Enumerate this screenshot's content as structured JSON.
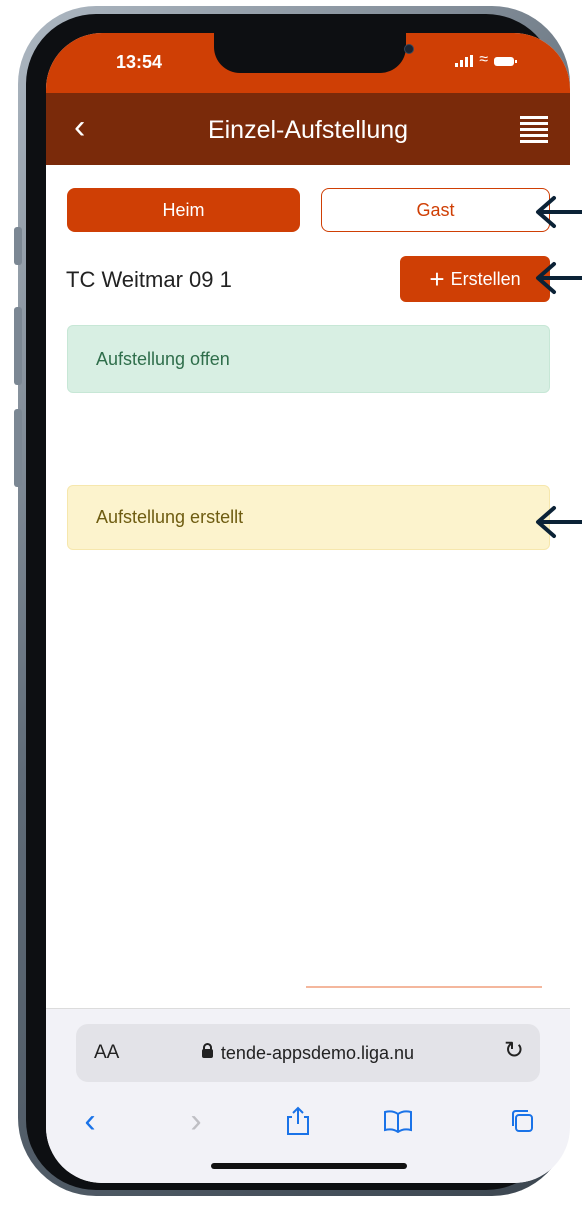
{
  "status_bar": {
    "time": "13:54"
  },
  "nav": {
    "title": "Einzel-Aufstellung"
  },
  "tabs": {
    "home_label": "Heim",
    "guest_label": "Gast"
  },
  "team": {
    "name": "TC Weitmar 09 1"
  },
  "actions": {
    "create_label": "Erstellen"
  },
  "alerts": {
    "open_text": "Aufstellung offen",
    "created_text": "Aufstellung erstellt"
  },
  "browser": {
    "text_size_label": "AA",
    "url": "tende-appsdemo.liga.nu"
  },
  "colors": {
    "accent": "#cf3f05",
    "nav_background": "#7a2a0a",
    "success_background": "#d8efe3",
    "warning_background": "#fcf3cd",
    "ios_link": "#1a73e8"
  }
}
